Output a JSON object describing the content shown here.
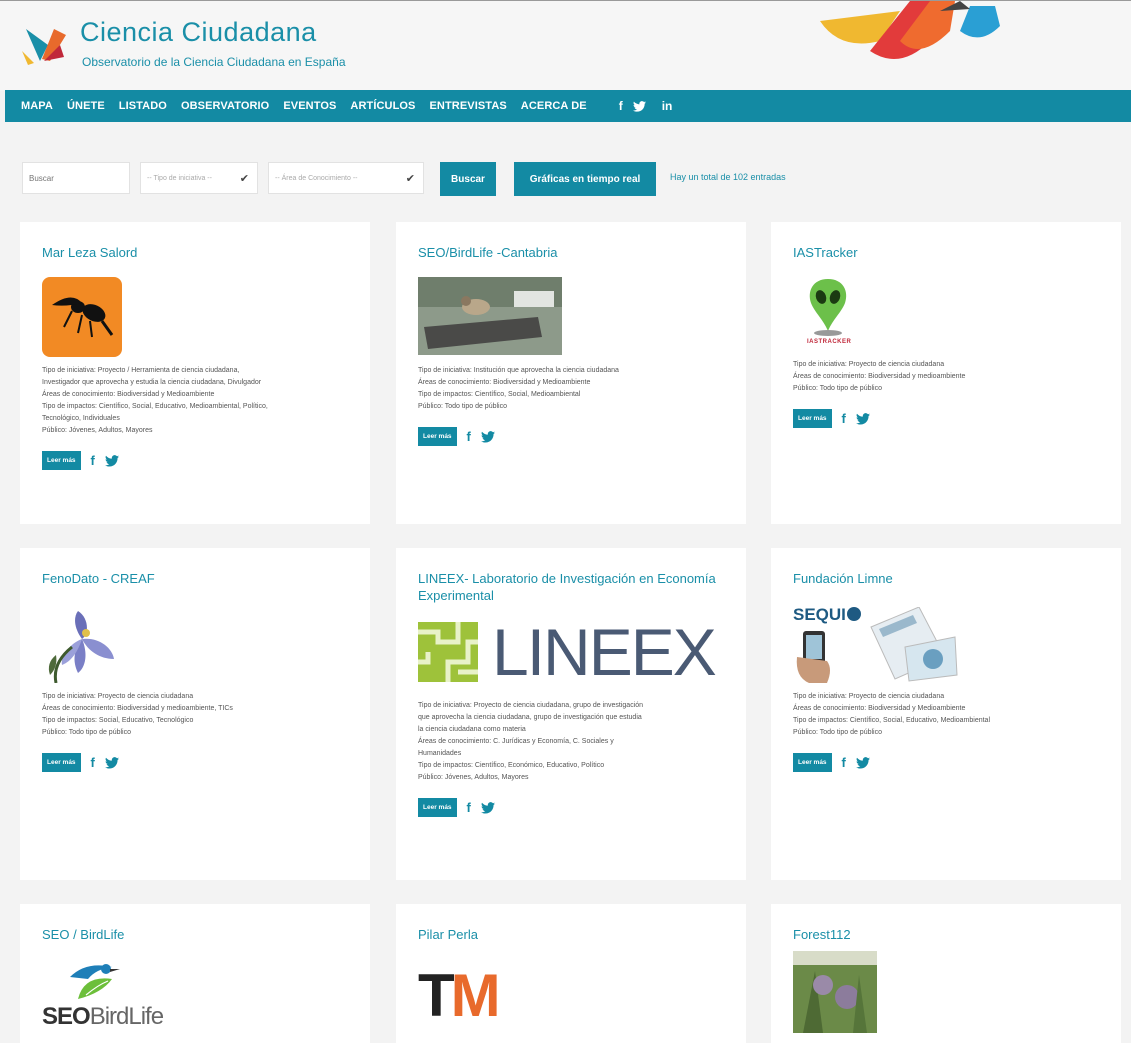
{
  "header": {
    "title": "Ciencia Ciudadana",
    "subtitle": "Observatorio de la Ciencia Ciudadana en España"
  },
  "nav": {
    "items": [
      "MAPA",
      "ÚNETE",
      "LISTADO",
      "OBSERVATORIO",
      "EVENTOS",
      "ARTÍCULOS",
      "ENTREVISTAS",
      "ACERCA DE"
    ],
    "social": [
      "f",
      "in"
    ]
  },
  "filters": {
    "search_placeholder": "Buscar",
    "tipo_select": "-- Tipo de iniciativa --",
    "area_select": "-- Área de Conocimiento --",
    "search_button": "Buscar",
    "charts_button": "Gráficas en tiempo real",
    "total_text": "Hay un total de 102 entradas"
  },
  "colors": {
    "accent": "#138aa3",
    "title": "#1a8fa8"
  },
  "cards": [
    {
      "title": "Mar Leza Salord",
      "logo": "wasp-icon",
      "desc": [
        "Tipo de iniciativa: Proyecto / Herramienta de ciencia ciudadana,",
        "Investigador que aprovecha y estudia la ciencia ciudadana, Divulgador",
        "Áreas de conocimiento: Biodiversidad y Medioambiente",
        "Tipo de impactos: Científico, Social, Educativo, Medioambiental, Político,",
        "Tecnológico, Individuales",
        "Público: Jóvenes, Adultos, Mayores"
      ],
      "leer": "Leer más"
    },
    {
      "title": "SEO/BirdLife -Cantabria",
      "logo": "bird-photo",
      "desc": [
        "Tipo de iniciativa: Institución que aprovecha la ciencia ciudadana",
        "Áreas de conocimiento: Biodiversidad y Medioambiente",
        "Tipo de impactos: Científico, Social, Medioambiental",
        "Público: Todo tipo de público"
      ],
      "leer": "Leer más"
    },
    {
      "title": "IASTracker",
      "logo": "alien-pin-icon",
      "logo_text": "IASTRACKER",
      "desc": [
        "Tipo de iniciativa: Proyecto de ciencia ciudadana",
        "Áreas de conocimiento: Biodiversidad y medioambiente",
        "Público: Todo tipo de público"
      ],
      "leer": "Leer más"
    },
    {
      "title": "FenoDato - CREAF",
      "logo": "flower-icon",
      "desc": [
        "Tipo de iniciativa: Proyecto de ciencia ciudadana",
        "Áreas de conocimiento: Biodiversidad y medioambiente, TICs",
        "Tipo de impactos: Social, Educativo, Tecnológico",
        "Público: Todo tipo de público"
      ],
      "leer": "Leer más"
    },
    {
      "title": "LINEEX- Laboratorio de Investigación en Economía Experimental",
      "logo": "lineex-logo",
      "logo_text": "LINEEX",
      "desc": [
        "Tipo de iniciativa: Proyecto de ciencia ciudadana, grupo de investigación",
        "que aprovecha la ciencia ciudadana, grupo de investigación que estudia",
        "la ciencia ciudadana como materia",
        "Áreas de conocimiento: C. Jurídicas y Economía, C. Sociales y",
        "Humanidades",
        "Tipo de impactos: Científico, Económico, Educativo, Político",
        "Público: Jóvenes, Adultos, Mayores"
      ],
      "leer": "Leer más"
    },
    {
      "title": "Fundación Limne",
      "logo": "sequi-logo",
      "logo_text": "SEQUI",
      "desc": [
        "Tipo de iniciativa: Proyecto de ciencia ciudadana",
        "Áreas de conocimiento: Biodiversidad y Medioambiente",
        "Tipo de impactos: Científico, Social, Educativo, Medioambiental",
        "Público: Todo tipo de público"
      ],
      "leer": "Leer más"
    },
    {
      "title": "SEO / BirdLife",
      "logo": "seo-birdlife-logo",
      "logo_text_a": "SEO",
      "logo_text_b": "BirdLife",
      "desc": [],
      "leer": ""
    },
    {
      "title": "Pilar Perla",
      "logo": "tm-logo",
      "logo_text_a": "T",
      "logo_text_b": "M",
      "desc": [],
      "leer": ""
    },
    {
      "title": "Forest112",
      "logo": "forest-photo",
      "desc": [],
      "leer": ""
    }
  ]
}
